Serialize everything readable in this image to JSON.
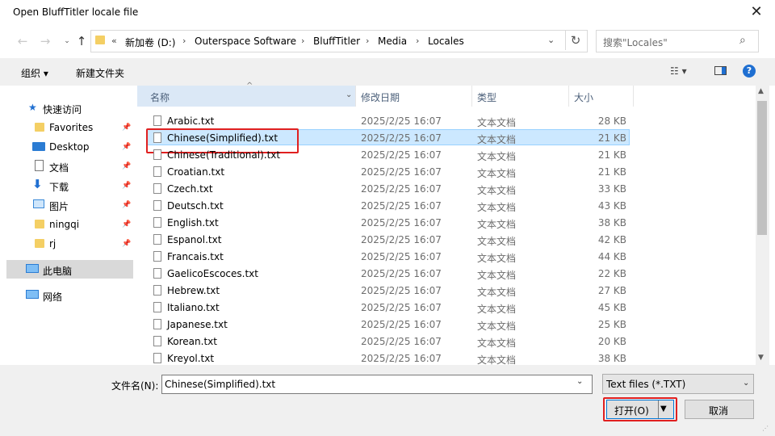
{
  "window": {
    "title": "Open BluffTitler locale file"
  },
  "address": {
    "crumbs": [
      "新加卷 (D:)",
      "Outerspace Software",
      "BluffTitler",
      "Media",
      "Locales"
    ],
    "overflow": "«"
  },
  "search": {
    "placeholder": "搜索\"Locales\""
  },
  "toolbar": {
    "organize": "组织 ▾",
    "new_folder": "新建文件夹"
  },
  "sidebar": {
    "quick_access": "快速访问",
    "items": [
      {
        "label": "Favorites",
        "icon": "folder-icon"
      },
      {
        "label": "Desktop",
        "icon": "desktop-icon"
      },
      {
        "label": "文档",
        "icon": "document-icon"
      },
      {
        "label": "下载",
        "icon": "download-icon"
      },
      {
        "label": "图片",
        "icon": "picture-icon"
      },
      {
        "label": "ningqi",
        "icon": "folder-icon"
      },
      {
        "label": "rj",
        "icon": "folder-icon"
      }
    ],
    "this_pc": "此电脑",
    "network": "网络"
  },
  "columns": {
    "name": "名称",
    "date": "修改日期",
    "type": "类型",
    "size": "大小"
  },
  "files": [
    {
      "name": "Arabic.txt",
      "date": "2025/2/25 16:07",
      "type": "文本文档",
      "size": "28 KB"
    },
    {
      "name": "Chinese(Simplified).txt",
      "date": "2025/2/25 16:07",
      "type": "文本文档",
      "size": "21 KB"
    },
    {
      "name": "Chinese(Traditional).txt",
      "date": "2025/2/25 16:07",
      "type": "文本文档",
      "size": "21 KB"
    },
    {
      "name": "Croatian.txt",
      "date": "2025/2/25 16:07",
      "type": "文本文档",
      "size": "21 KB"
    },
    {
      "name": "Czech.txt",
      "date": "2025/2/25 16:07",
      "type": "文本文档",
      "size": "33 KB"
    },
    {
      "name": "Deutsch.txt",
      "date": "2025/2/25 16:07",
      "type": "文本文档",
      "size": "43 KB"
    },
    {
      "name": "English.txt",
      "date": "2025/2/25 16:07",
      "type": "文本文档",
      "size": "38 KB"
    },
    {
      "name": "Espanol.txt",
      "date": "2025/2/25 16:07",
      "type": "文本文档",
      "size": "42 KB"
    },
    {
      "name": "Francais.txt",
      "date": "2025/2/25 16:07",
      "type": "文本文档",
      "size": "44 KB"
    },
    {
      "name": "GaelicoEscoces.txt",
      "date": "2025/2/25 16:07",
      "type": "文本文档",
      "size": "22 KB"
    },
    {
      "name": "Hebrew.txt",
      "date": "2025/2/25 16:07",
      "type": "文本文档",
      "size": "27 KB"
    },
    {
      "name": "Italiano.txt",
      "date": "2025/2/25 16:07",
      "type": "文本文档",
      "size": "45 KB"
    },
    {
      "name": "Japanese.txt",
      "date": "2025/2/25 16:07",
      "type": "文本文档",
      "size": "25 KB"
    },
    {
      "name": "Korean.txt",
      "date": "2025/2/25 16:07",
      "type": "文本文档",
      "size": "20 KB"
    },
    {
      "name": "Kreyol.txt",
      "date": "2025/2/25 16:07",
      "type": "文本文档",
      "size": "38 KB"
    }
  ],
  "selected_index": 1,
  "bottom": {
    "filename_label": "文件名(N):",
    "filename_value": "Chinese(Simplified).txt",
    "filetype": "Text files (*.TXT)",
    "open": "打开(O)",
    "cancel": "取消"
  },
  "colors": {
    "selection": "#cce8ff",
    "highlight": "#e02020",
    "accent": "#0078d7"
  }
}
